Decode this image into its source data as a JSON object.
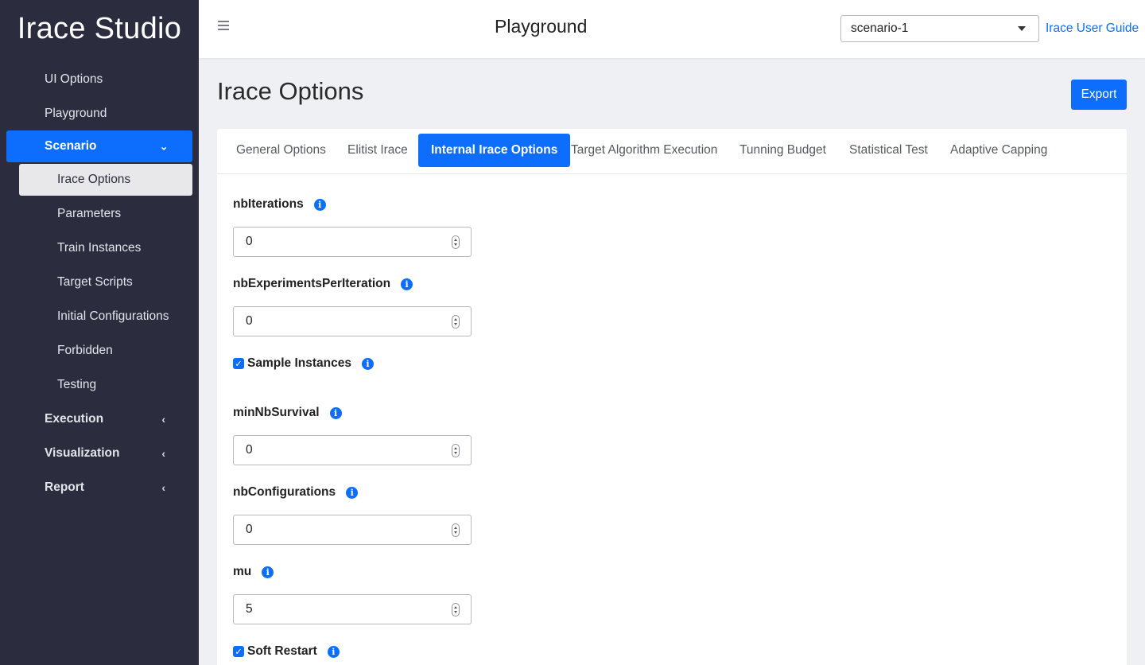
{
  "app": {
    "brand": "Irace Studio"
  },
  "topbar": {
    "title": "Playground",
    "scenario_select": {
      "value": "scenario-1"
    },
    "guide_link": "Irace User Guide"
  },
  "sidebar": {
    "items": [
      {
        "label": "UI Options"
      },
      {
        "label": "Playground"
      },
      {
        "label": "Scenario",
        "chevron": "⌄"
      },
      {
        "label": "Irace Options"
      },
      {
        "label": "Parameters"
      },
      {
        "label": "Train Instances"
      },
      {
        "label": "Target Scripts"
      },
      {
        "label": "Initial Configurations"
      },
      {
        "label": "Forbidden"
      },
      {
        "label": "Testing"
      },
      {
        "label": "Execution"
      },
      {
        "label": "Visualization"
      },
      {
        "label": "Report"
      }
    ]
  },
  "page": {
    "title": "Irace Options",
    "export_label": "Export"
  },
  "tabs": [
    {
      "label": "General Options"
    },
    {
      "label": "Elitist Irace"
    },
    {
      "label": "Internal Irace Options"
    },
    {
      "label": "Target Algorithm Execution"
    },
    {
      "label": "Tunning Budget"
    },
    {
      "label": "Statistical Test"
    },
    {
      "label": "Adaptive Capping"
    }
  ],
  "fields": {
    "nbIterations": {
      "label": "nbIterations",
      "value": "0"
    },
    "nbExperimentsPerIteration": {
      "label": "nbExperimentsPerIteration",
      "value": "0"
    },
    "sampleInstances": {
      "label": "Sample Instances",
      "checked": true
    },
    "minNbSurvival": {
      "label": "minNbSurvival",
      "value": "0"
    },
    "nbConfigurations": {
      "label": "nbConfigurations",
      "value": "0"
    },
    "mu": {
      "label": "mu",
      "value": "5"
    },
    "softRestart": {
      "label": "Soft Restart",
      "checked": true
    }
  },
  "colors": {
    "accent": "#0d6efd",
    "sidebar_bg": "#2b2d3f"
  }
}
